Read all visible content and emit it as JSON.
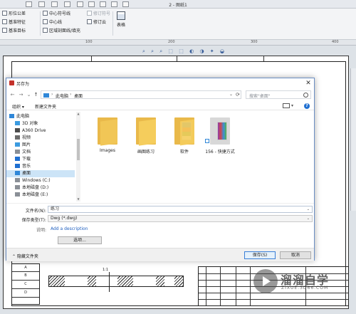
{
  "cad": {
    "doc_title": "2 - 图纸1",
    "ribbon": {
      "items": [
        "形位公差",
        "基准特征",
        "基准目标",
        "中心符号线",
        "中心线",
        "区域剖面线/填充",
        "修订符号",
        "修订云"
      ],
      "table_label": "表格"
    },
    "ruler_ticks": [
      "100",
      "200",
      "300",
      "400"
    ],
    "view_tools": "⌕ ⌕ ⌕ ⬚ ⬚ ◐ ◑ ✦ ◒",
    "title_block_left": [
      "A",
      "B",
      "C",
      "D"
    ],
    "part_dim": "1:1"
  },
  "watermark": {
    "cn": "溜溜自学",
    "url": "ZIXUE.3D66.COM"
  },
  "dialog": {
    "title": "另存为",
    "close_glyph": "✕",
    "nav": {
      "back": "←",
      "forward": "→",
      "up_drop": "⌄",
      "up": "↑"
    },
    "address": {
      "crumbs": [
        "此电脑",
        "桌面"
      ],
      "sep": "›",
      "drop": "⌄",
      "refresh": "⟳"
    },
    "search_placeholder": "搜索\"桌面\"",
    "commands": {
      "organize": "组织 ▾",
      "new_folder": "新建文件夹",
      "view_drop": "▾",
      "help": "?"
    },
    "nav_pane": [
      {
        "label": "此电脑",
        "icon_color": "#2f87d8"
      },
      {
        "label": "3D 对象",
        "icon_color": "#3b9be0"
      },
      {
        "label": "A360 Drive",
        "icon_color": "#4c4c4c"
      },
      {
        "label": "视频",
        "icon_color": "#6b6b6b"
      },
      {
        "label": "图片",
        "icon_color": "#3b9be0"
      },
      {
        "label": "文档",
        "icon_color": "#8a8f96"
      },
      {
        "label": "下载",
        "icon_color": "#1f6fd1"
      },
      {
        "label": "音乐",
        "icon_color": "#1f6fd1"
      },
      {
        "label": "桌面",
        "icon_color": "#2f87d8",
        "selected": true
      },
      {
        "label": "Windows (C:)",
        "icon_color": "#8a8f96"
      },
      {
        "label": "本地磁盘 (D:)",
        "icon_color": "#8a8f96"
      },
      {
        "label": "本地磁盘 (E:)",
        "icon_color": "#8a8f96"
      }
    ],
    "scroll": {
      "up": "▲",
      "down": "▼"
    },
    "files": [
      {
        "label": "Images",
        "type": "folder"
      },
      {
        "label": "画图练习",
        "type": "folder"
      },
      {
        "label": "软件",
        "type": "folder-images"
      },
      {
        "label": "156 - 快捷方式",
        "type": "shortcut"
      }
    ],
    "form": {
      "filename_label": "文件名(N):",
      "filename_value": "练习",
      "filetype_label": "保存类型(T):",
      "filetype_value": "Dwg (*.dwg)",
      "dropdown_glyph": "⌄",
      "description_label": "说明:",
      "description_link": "Add a description",
      "options_button": "选项..."
    },
    "bottom": {
      "hide_folders": "⌃ 隐藏文件夹",
      "save": "保存(S)",
      "cancel": "取消"
    }
  }
}
